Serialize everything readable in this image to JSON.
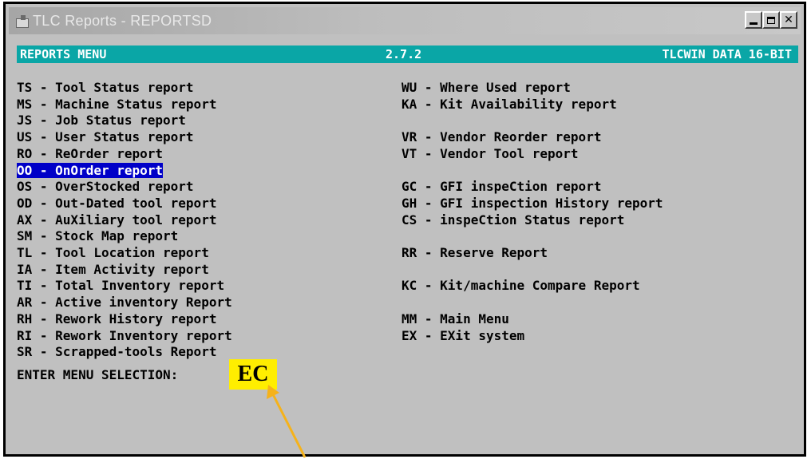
{
  "window": {
    "title": "TLC Reports - REPORTSD"
  },
  "header": {
    "left": "REPORTS MENU",
    "center": "2.7.2",
    "right": "TLCWIN DATA 16-BIT"
  },
  "menu": {
    "left": [
      {
        "code": "TS",
        "label": "Tool Status report"
      },
      {
        "code": "MS",
        "label": "Machine Status report"
      },
      {
        "code": "JS",
        "label": "Job Status report"
      },
      {
        "code": "US",
        "label": "User Status report"
      },
      {
        "code": "RO",
        "label": "ReOrder report"
      },
      {
        "code": "OO",
        "label": "OnOrder report"
      },
      {
        "code": "OS",
        "label": "OverStocked report"
      },
      {
        "code": "OD",
        "label": "Out-Dated tool report"
      },
      {
        "code": "AX",
        "label": "AuXiliary tool report"
      },
      {
        "code": "SM",
        "label": "Stock Map report"
      },
      {
        "code": "TL",
        "label": "Tool Location report"
      },
      {
        "code": "IA",
        "label": "Item Activity report"
      },
      {
        "code": "TI",
        "label": "Total Inventory report"
      },
      {
        "code": "AR",
        "label": "Active inventory Report"
      },
      {
        "code": "RH",
        "label": "Rework History report"
      },
      {
        "code": "RI",
        "label": "Rework Inventory report"
      },
      {
        "code": "SR",
        "label": "Scrapped-tools Report"
      }
    ],
    "right": [
      {
        "code": "WU",
        "label": "Where Used report"
      },
      {
        "code": "KA",
        "label": "Kit Availability report"
      },
      {
        "code": "VR",
        "label": "Vendor Reorder report"
      },
      {
        "code": "VT",
        "label": "Vendor Tool report"
      },
      {
        "code": "GC",
        "label": "GFI inspeCtion report"
      },
      {
        "code": "GH",
        "label": "GFI inspection History report"
      },
      {
        "code": "CS",
        "label": "inspeCtion Status report"
      },
      {
        "code": "RR",
        "label": "Reserve Report"
      },
      {
        "code": "KC",
        "label": "Kit/machine Compare Report"
      },
      {
        "code": "MM",
        "label": "Main Menu"
      },
      {
        "code": "EX",
        "label": "EXit system"
      }
    ],
    "selected_code": "OO"
  },
  "prompt": {
    "label": "ENTER MENU SELECTION:",
    "value": "EC"
  },
  "colors": {
    "header_bg": "#0aa6a6",
    "selection_bg": "#0000c8",
    "highlight": "#ffee00",
    "arrow": "#f5b21b"
  }
}
